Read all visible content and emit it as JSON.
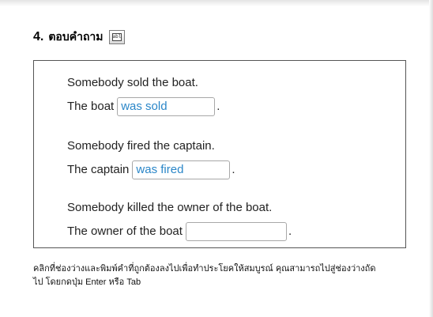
{
  "question": {
    "number": "4.",
    "title": "ตอบคำถาม",
    "icon": "fill-in-blank-icon",
    "icon_text": "abl"
  },
  "items": [
    {
      "prompt": "Somebody sold the boat.",
      "answer_prefix": "The boat",
      "answer_value": "was sold",
      "suffix": "."
    },
    {
      "prompt": "Somebody fired the captain.",
      "answer_prefix": "The captain",
      "answer_value": "was fired",
      "suffix": "."
    },
    {
      "prompt": "Somebody killed the owner of the boat.",
      "answer_prefix": "The owner of the boat",
      "answer_value": "",
      "suffix": "."
    }
  ],
  "instruction": {
    "line1": "คลิกที่ช่องว่างและพิมพ์คำที่ถูกต้องลงไปเพื่อทำประโยคให้สมบูรณ์ คุณสามารถไปสู่ช่องว่างถัด",
    "line2": "ไป โดยกดปุ่ม Enter หรือ Tab"
  },
  "colors": {
    "answer_text": "#2a86c8",
    "box_border": "#555555",
    "input_border": "#a8a8a8"
  }
}
